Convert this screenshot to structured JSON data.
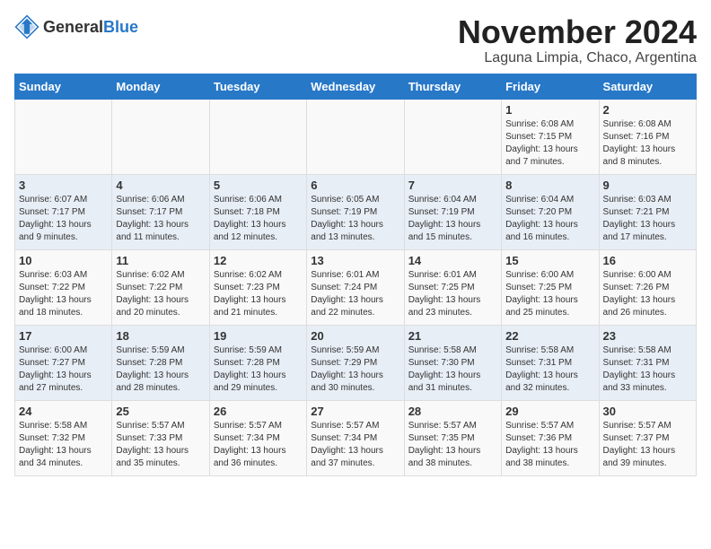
{
  "header": {
    "logo_general": "General",
    "logo_blue": "Blue",
    "month": "November 2024",
    "location": "Laguna Limpia, Chaco, Argentina"
  },
  "weekdays": [
    "Sunday",
    "Monday",
    "Tuesday",
    "Wednesday",
    "Thursday",
    "Friday",
    "Saturday"
  ],
  "weeks": [
    [
      {
        "day": "",
        "info": ""
      },
      {
        "day": "",
        "info": ""
      },
      {
        "day": "",
        "info": ""
      },
      {
        "day": "",
        "info": ""
      },
      {
        "day": "",
        "info": ""
      },
      {
        "day": "1",
        "info": "Sunrise: 6:08 AM\nSunset: 7:15 PM\nDaylight: 13 hours and 7 minutes."
      },
      {
        "day": "2",
        "info": "Sunrise: 6:08 AM\nSunset: 7:16 PM\nDaylight: 13 hours and 8 minutes."
      }
    ],
    [
      {
        "day": "3",
        "info": "Sunrise: 6:07 AM\nSunset: 7:17 PM\nDaylight: 13 hours and 9 minutes."
      },
      {
        "day": "4",
        "info": "Sunrise: 6:06 AM\nSunset: 7:17 PM\nDaylight: 13 hours and 11 minutes."
      },
      {
        "day": "5",
        "info": "Sunrise: 6:06 AM\nSunset: 7:18 PM\nDaylight: 13 hours and 12 minutes."
      },
      {
        "day": "6",
        "info": "Sunrise: 6:05 AM\nSunset: 7:19 PM\nDaylight: 13 hours and 13 minutes."
      },
      {
        "day": "7",
        "info": "Sunrise: 6:04 AM\nSunset: 7:19 PM\nDaylight: 13 hours and 15 minutes."
      },
      {
        "day": "8",
        "info": "Sunrise: 6:04 AM\nSunset: 7:20 PM\nDaylight: 13 hours and 16 minutes."
      },
      {
        "day": "9",
        "info": "Sunrise: 6:03 AM\nSunset: 7:21 PM\nDaylight: 13 hours and 17 minutes."
      }
    ],
    [
      {
        "day": "10",
        "info": "Sunrise: 6:03 AM\nSunset: 7:22 PM\nDaylight: 13 hours and 18 minutes."
      },
      {
        "day": "11",
        "info": "Sunrise: 6:02 AM\nSunset: 7:22 PM\nDaylight: 13 hours and 20 minutes."
      },
      {
        "day": "12",
        "info": "Sunrise: 6:02 AM\nSunset: 7:23 PM\nDaylight: 13 hours and 21 minutes."
      },
      {
        "day": "13",
        "info": "Sunrise: 6:01 AM\nSunset: 7:24 PM\nDaylight: 13 hours and 22 minutes."
      },
      {
        "day": "14",
        "info": "Sunrise: 6:01 AM\nSunset: 7:25 PM\nDaylight: 13 hours and 23 minutes."
      },
      {
        "day": "15",
        "info": "Sunrise: 6:00 AM\nSunset: 7:25 PM\nDaylight: 13 hours and 25 minutes."
      },
      {
        "day": "16",
        "info": "Sunrise: 6:00 AM\nSunset: 7:26 PM\nDaylight: 13 hours and 26 minutes."
      }
    ],
    [
      {
        "day": "17",
        "info": "Sunrise: 6:00 AM\nSunset: 7:27 PM\nDaylight: 13 hours and 27 minutes."
      },
      {
        "day": "18",
        "info": "Sunrise: 5:59 AM\nSunset: 7:28 PM\nDaylight: 13 hours and 28 minutes."
      },
      {
        "day": "19",
        "info": "Sunrise: 5:59 AM\nSunset: 7:28 PM\nDaylight: 13 hours and 29 minutes."
      },
      {
        "day": "20",
        "info": "Sunrise: 5:59 AM\nSunset: 7:29 PM\nDaylight: 13 hours and 30 minutes."
      },
      {
        "day": "21",
        "info": "Sunrise: 5:58 AM\nSunset: 7:30 PM\nDaylight: 13 hours and 31 minutes."
      },
      {
        "day": "22",
        "info": "Sunrise: 5:58 AM\nSunset: 7:31 PM\nDaylight: 13 hours and 32 minutes."
      },
      {
        "day": "23",
        "info": "Sunrise: 5:58 AM\nSunset: 7:31 PM\nDaylight: 13 hours and 33 minutes."
      }
    ],
    [
      {
        "day": "24",
        "info": "Sunrise: 5:58 AM\nSunset: 7:32 PM\nDaylight: 13 hours and 34 minutes."
      },
      {
        "day": "25",
        "info": "Sunrise: 5:57 AM\nSunset: 7:33 PM\nDaylight: 13 hours and 35 minutes."
      },
      {
        "day": "26",
        "info": "Sunrise: 5:57 AM\nSunset: 7:34 PM\nDaylight: 13 hours and 36 minutes."
      },
      {
        "day": "27",
        "info": "Sunrise: 5:57 AM\nSunset: 7:34 PM\nDaylight: 13 hours and 37 minutes."
      },
      {
        "day": "28",
        "info": "Sunrise: 5:57 AM\nSunset: 7:35 PM\nDaylight: 13 hours and 38 minutes."
      },
      {
        "day": "29",
        "info": "Sunrise: 5:57 AM\nSunset: 7:36 PM\nDaylight: 13 hours and 38 minutes."
      },
      {
        "day": "30",
        "info": "Sunrise: 5:57 AM\nSunset: 7:37 PM\nDaylight: 13 hours and 39 minutes."
      }
    ]
  ]
}
